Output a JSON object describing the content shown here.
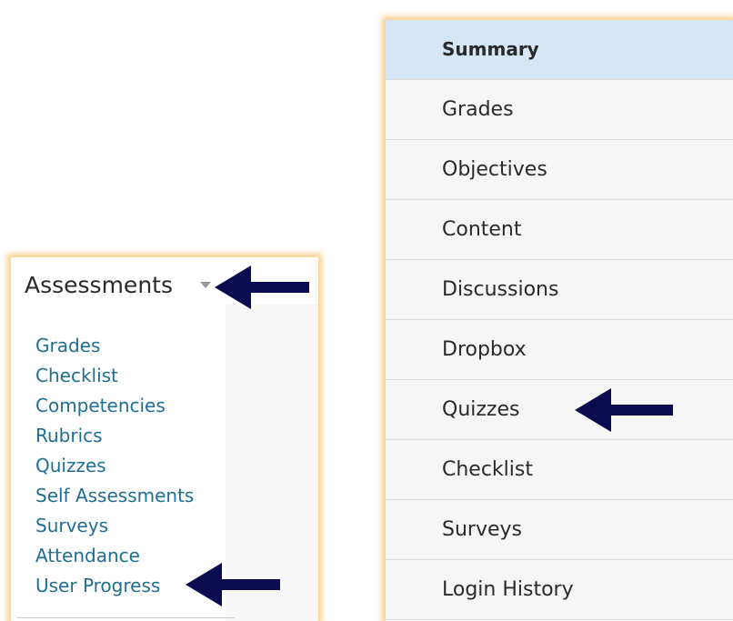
{
  "assessments": {
    "title": "Assessments",
    "links": [
      "Grades",
      "Checklist",
      "Competencies",
      "Rubrics",
      "Quizzes",
      "Self Assessments",
      "Surveys",
      "Attendance",
      "User Progress"
    ]
  },
  "nav": {
    "items": [
      {
        "label": "Summary",
        "active": true
      },
      {
        "label": "Grades"
      },
      {
        "label": "Objectives"
      },
      {
        "label": "Content"
      },
      {
        "label": "Discussions"
      },
      {
        "label": "Dropbox"
      },
      {
        "label": "Quizzes"
      },
      {
        "label": "Checklist"
      },
      {
        "label": "Surveys"
      },
      {
        "label": "Login History"
      }
    ]
  },
  "colors": {
    "link": "#1f6f93",
    "active_bg": "#d6e6f7",
    "arrow": "#0d0b50",
    "highlight_glow": "#f9c878"
  },
  "icons": {
    "dropdown": "caret-down-icon",
    "pointer": "left-arrow-icon"
  }
}
